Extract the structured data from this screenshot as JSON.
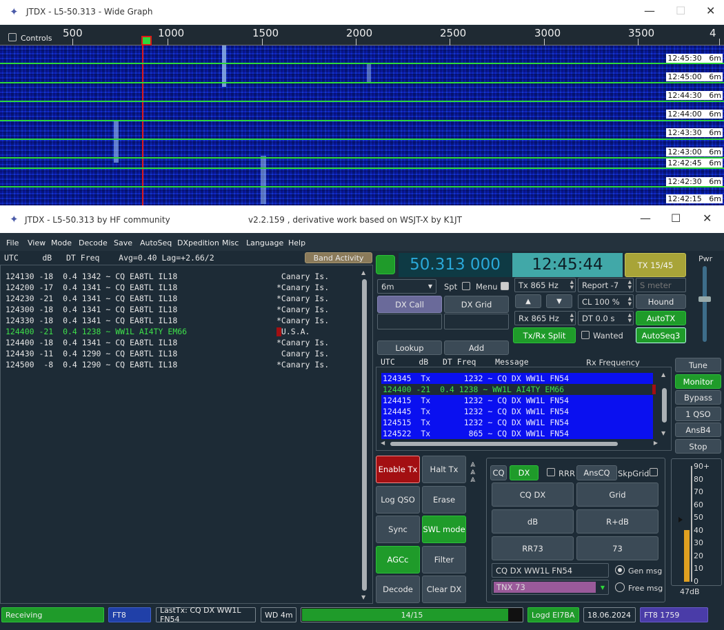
{
  "wide_graph": {
    "title": "JTDX - L5-50.313 - Wide Graph",
    "controls_label": "Controls",
    "freq_ticks": [
      "500",
      "1000",
      "1500",
      "2000",
      "2500",
      "3000",
      "3500",
      "4"
    ],
    "time_labels": [
      {
        "t": "12:45:30",
        "b": "6m"
      },
      {
        "t": "12:45:00",
        "b": "6m"
      },
      {
        "t": "12:44:30",
        "b": "6m"
      },
      {
        "t": "12:44:00",
        "b": "6m"
      },
      {
        "t": "12:43:30",
        "b": "6m"
      },
      {
        "t": "12:43:00",
        "b": "6m"
      },
      {
        "t": "12:42:45",
        "b": "6m"
      },
      {
        "t": "12:42:30",
        "b": "6m"
      },
      {
        "t": "12:42:15",
        "b": "6m"
      }
    ]
  },
  "main": {
    "title": "JTDX - L5-50.313  by HF community",
    "subtitle": "v2.2.159 , derivative work based on WSJT-X by K1JT",
    "menu": [
      "File",
      "View",
      "Mode",
      "Decode",
      "Save",
      "AutoSeq",
      "DXpedition",
      "Misc",
      "Language",
      "Help"
    ]
  },
  "band_activity": {
    "header": "UTC     dB   DT Freq    Avg=0.40 Lag=+2.66/2",
    "button": "Band Activity",
    "rows": [
      {
        "text": "124130 -18  0.4 1342 ~ CQ EA8TL IL18",
        "country": " Canary Is.",
        "color": "#e6e6e6"
      },
      {
        "text": "124200 -17  0.4 1341 ~ CQ EA8TL IL18",
        "country": "*Canary Is.",
        "color": "#e6e6e6"
      },
      {
        "text": "124230 -21  0.4 1341 ~ CQ EA8TL IL18",
        "country": "*Canary Is.",
        "color": "#e6e6e6"
      },
      {
        "text": "124300 -18  0.4 1341 ~ CQ EA8TL IL18",
        "country": "*Canary Is.",
        "color": "#e6e6e6"
      },
      {
        "text": "124330 -18  0.4 1341 ~ CQ EA8TL IL18",
        "country": "*Canary Is.",
        "color": "#e6e6e6"
      },
      {
        "text": "124400 -21  0.4 1238 ~ WW1L AI4TY EM66",
        "country": " U.S.A.",
        "color": "#3ee04a"
      },
      {
        "text": "124400 -18  0.4 1341 ~ CQ EA8TL IL18",
        "country": "*Canary Is.",
        "color": "#e6e6e6"
      },
      {
        "text": "124430 -11  0.4 1290 ~ CQ EA8TL IL18",
        "country": " Canary Is.",
        "color": "#e6e6e6"
      },
      {
        "text": "124500  -8  0.4 1290 ~ CQ EA8TL IL18",
        "country": "*Canary Is.",
        "color": "#e6e6e6"
      }
    ]
  },
  "controls": {
    "frequency": "50.313 000",
    "clock": "12:45:44",
    "tx_period": "TX 15/45",
    "band": "6m",
    "spt": "Spt",
    "menu": "Menu",
    "tx_freq": "Tx  865  Hz",
    "rx_freq": "Rx  865  Hz",
    "report": "Report -7",
    "smeter": "S meter",
    "cl": "CL  100 %",
    "dt": "DT 0.0 s",
    "dx_call": "DX Call",
    "dx_grid": "DX Grid",
    "lookup": "Lookup",
    "add": "Add",
    "hound": "Hound",
    "autotx": "AutoTX",
    "txrx_split": "Tx/Rx Split",
    "wanted": "Wanted",
    "autoseq": "AutoSeq3",
    "up": "▲",
    "down": "▼",
    "pwr": "Pwr"
  },
  "rx_freq": {
    "header": "UTC     dB   DT Freq    Message",
    "header2": "Rx Frequency",
    "rows": [
      {
        "text": "124345  Tx       1232 ~ CQ DX WW1L FN54",
        "kind": "tx"
      },
      {
        "text": "124400 -21  0.4 1238 ~ WW1L AI4TY EM66",
        "kind": "rx"
      },
      {
        "text": "124415  Tx       1232 ~ CQ DX WW1L FN54",
        "kind": "tx"
      },
      {
        "text": "124445  Tx       1232 ~ CQ DX WW1L FN54",
        "kind": "tx"
      },
      {
        "text": "124515  Tx       1232 ~ CQ DX WW1L FN54",
        "kind": "tx"
      },
      {
        "text": "124522  Tx        865 ~ CQ DX WW1L FN54",
        "kind": "tx"
      }
    ]
  },
  "side_buttons": [
    "Tune",
    "Monitor",
    "Bypass",
    "1 QSO",
    "AnsB4",
    "Stop"
  ],
  "left_buttons": {
    "enable_tx": "Enable Tx",
    "halt_tx": "Halt Tx",
    "log_qso": "Log QSO",
    "erase": "Erase",
    "sync": "Sync",
    "swl": "SWL mode",
    "agcc": "AGCc",
    "filter": "Filter",
    "decode": "Decode",
    "clear_dx": "Clear DX"
  },
  "macros": {
    "cq": "CQ",
    "dx": "DX",
    "rrr": "RRR",
    "anscq": "AnsCQ",
    "skpgrid": "SkpGrid",
    "cq_dx": "CQ DX",
    "grid": "Grid",
    "db": "dB",
    "rdb": "R+dB",
    "rr73": "RR73",
    "s73": "73",
    "gen_text": "CQ DX WW1L FN54",
    "free_text": "TNX 73",
    "gen_msg": "Gen msg",
    "free_msg": "Free msg"
  },
  "meter": {
    "scale": [
      "90+",
      "80",
      "70",
      "60",
      "50",
      "40",
      "30",
      "20",
      "10",
      "0"
    ],
    "reading": "47dB",
    "level_db": 40
  },
  "status": {
    "state": "Receiving",
    "mode": "FT8",
    "last_tx": "LastTx: CQ DX WW1L FN54",
    "wd": "WD 4m",
    "progress": "14/15",
    "progress_frac": 0.93,
    "logd": "Logd EI7BA",
    "date": "18.06.2024",
    "mode2": "FT8  1759"
  }
}
